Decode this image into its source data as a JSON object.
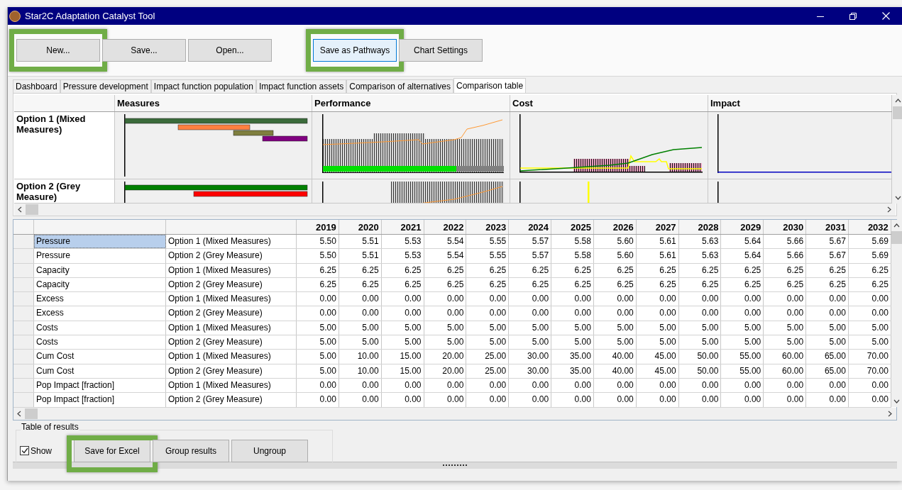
{
  "window": {
    "title": "Star2C Adaptation Catalyst Tool"
  },
  "toolbar": {
    "buttons": [
      {
        "label": "New...",
        "highlighted": true,
        "focused": false,
        "gap": false
      },
      {
        "label": "Save...",
        "highlighted": false,
        "focused": false,
        "gap": false
      },
      {
        "label": "Open...",
        "highlighted": false,
        "focused": false,
        "gap": false
      },
      {
        "label": "Save as Pathways",
        "highlighted": true,
        "focused": true,
        "gap": true
      },
      {
        "label": "Chart Settings",
        "highlighted": false,
        "focused": false,
        "gap": false
      }
    ]
  },
  "tabs": [
    {
      "label": "Dashboard",
      "selected": false
    },
    {
      "label": "Pressure development",
      "selected": false
    },
    {
      "label": "Impact function population",
      "selected": false
    },
    {
      "label": "Impact function assets",
      "selected": false
    },
    {
      "label": "Comparison of alternatives",
      "selected": false
    },
    {
      "label": "Comparison table",
      "selected": true
    }
  ],
  "chart_table": {
    "columns": [
      "Measures",
      "Performance",
      "Cost",
      "Impact"
    ],
    "rows": [
      {
        "label": "Option 1 (Mixed Measures)"
      },
      {
        "label": "Option 2 (Grey Measure)"
      }
    ]
  },
  "results": {
    "columns": [
      "2019",
      "2020",
      "2021",
      "2022",
      "2023",
      "2024",
      "2025",
      "2026",
      "2027",
      "2028",
      "2029",
      "2030",
      "2031",
      "2032"
    ],
    "rows": [
      {
        "variable": "Pressure",
        "option": "Option 1 (Mixed Measures)",
        "selected": true,
        "values": [
          "5.50",
          "5.51",
          "5.53",
          "5.54",
          "5.55",
          "5.57",
          "5.58",
          "5.60",
          "5.61",
          "5.63",
          "5.64",
          "5.66",
          "5.67",
          "5.69"
        ]
      },
      {
        "variable": "Pressure",
        "option": "Option 2 (Grey Measure)",
        "selected": false,
        "values": [
          "5.50",
          "5.51",
          "5.53",
          "5.54",
          "5.55",
          "5.57",
          "5.58",
          "5.60",
          "5.61",
          "5.63",
          "5.64",
          "5.66",
          "5.67",
          "5.69"
        ]
      },
      {
        "variable": "Capacity",
        "option": "Option 1 (Mixed Measures)",
        "selected": false,
        "values": [
          "6.25",
          "6.25",
          "6.25",
          "6.25",
          "6.25",
          "6.25",
          "6.25",
          "6.25",
          "6.25",
          "6.25",
          "6.25",
          "6.25",
          "6.25",
          "6.25"
        ]
      },
      {
        "variable": "Capacity",
        "option": "Option 2 (Grey Measure)",
        "selected": false,
        "values": [
          "6.25",
          "6.25",
          "6.25",
          "6.25",
          "6.25",
          "6.25",
          "6.25",
          "6.25",
          "6.25",
          "6.25",
          "6.25",
          "6.25",
          "6.25",
          "6.25"
        ]
      },
      {
        "variable": "Excess",
        "option": "Option 1 (Mixed Measures)",
        "selected": false,
        "values": [
          "0.00",
          "0.00",
          "0.00",
          "0.00",
          "0.00",
          "0.00",
          "0.00",
          "0.00",
          "0.00",
          "0.00",
          "0.00",
          "0.00",
          "0.00",
          "0.00"
        ]
      },
      {
        "variable": "Excess",
        "option": "Option 2 (Grey Measure)",
        "selected": false,
        "values": [
          "0.00",
          "0.00",
          "0.00",
          "0.00",
          "0.00",
          "0.00",
          "0.00",
          "0.00",
          "0.00",
          "0.00",
          "0.00",
          "0.00",
          "0.00",
          "0.00"
        ]
      },
      {
        "variable": "Costs",
        "option": "Option 1 (Mixed Measures)",
        "selected": false,
        "values": [
          "5.00",
          "5.00",
          "5.00",
          "5.00",
          "5.00",
          "5.00",
          "5.00",
          "5.00",
          "5.00",
          "5.00",
          "5.00",
          "5.00",
          "5.00",
          "5.00"
        ]
      },
      {
        "variable": "Costs",
        "option": "Option 2 (Grey Measure)",
        "selected": false,
        "values": [
          "5.00",
          "5.00",
          "5.00",
          "5.00",
          "5.00",
          "5.00",
          "5.00",
          "5.00",
          "5.00",
          "5.00",
          "5.00",
          "5.00",
          "5.00",
          "5.00"
        ]
      },
      {
        "variable": "Cum Cost",
        "option": "Option 1 (Mixed Measures)",
        "selected": false,
        "values": [
          "5.00",
          "10.00",
          "15.00",
          "20.00",
          "25.00",
          "30.00",
          "35.00",
          "40.00",
          "45.00",
          "50.00",
          "55.00",
          "60.00",
          "65.00",
          "70.00"
        ]
      },
      {
        "variable": "Cum Cost",
        "option": "Option 2 (Grey Measure)",
        "selected": false,
        "values": [
          "5.00",
          "10.00",
          "15.00",
          "20.00",
          "25.00",
          "30.00",
          "35.00",
          "40.00",
          "45.00",
          "50.00",
          "55.00",
          "60.00",
          "65.00",
          "70.00"
        ]
      },
      {
        "variable": "Pop Impact [fraction]",
        "option": "Option 1 (Mixed Measures)",
        "selected": false,
        "values": [
          "0.00",
          "0.00",
          "0.00",
          "0.00",
          "0.00",
          "0.00",
          "0.00",
          "0.00",
          "0.00",
          "0.00",
          "0.00",
          "0.00",
          "0.00",
          "0.00"
        ]
      },
      {
        "variable": "Pop Impact [fraction]",
        "option": "Option 2 (Grey Measure)",
        "selected": false,
        "values": [
          "0.00",
          "0.00",
          "0.00",
          "0.00",
          "0.00",
          "0.00",
          "0.00",
          "0.00",
          "0.00",
          "0.00",
          "0.00",
          "0.00",
          "0.00",
          "0.00"
        ]
      }
    ]
  },
  "bottom": {
    "group_title": "Table of results",
    "show": {
      "label": "Show",
      "checked": true
    },
    "buttons": [
      {
        "label": "Save for Excel",
        "highlighted": true
      },
      {
        "label": "Group results",
        "highlighted": false
      },
      {
        "label": "Ungroup",
        "highlighted": false
      }
    ]
  }
}
